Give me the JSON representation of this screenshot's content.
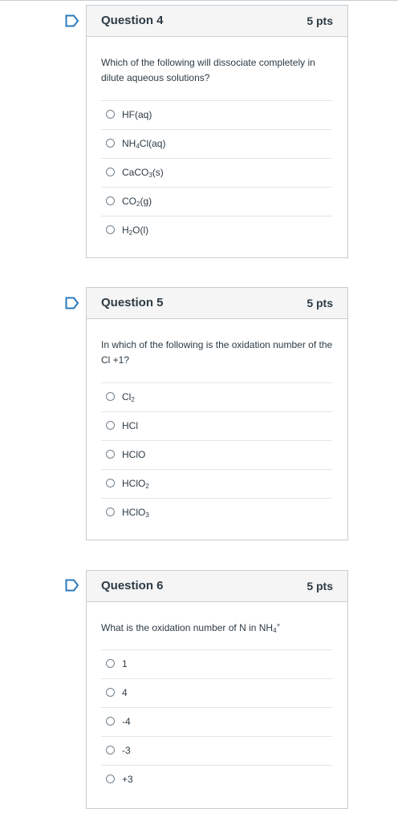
{
  "questions": [
    {
      "title": "Question 4",
      "points": "5 pts",
      "text": "Which of the following will dissociate completely in dilute aqueous solutions?",
      "answers": [
        {
          "label": "HF(aq)"
        },
        {
          "pre": "NH",
          "sub": "4",
          "post": "Cl(aq)"
        },
        {
          "pre": "CaCO",
          "sub": "3",
          "post": "(s)"
        },
        {
          "pre": "CO",
          "sub": "2",
          "post": "(g)"
        },
        {
          "pre": "H",
          "sub": "2",
          "post": "O(l)"
        }
      ]
    },
    {
      "title": "Question 5",
      "points": "5 pts",
      "text": "In which of the following is the oxidation number of the Cl +1?",
      "answers": [
        {
          "pre": "Cl",
          "sub": "2",
          "post": ""
        },
        {
          "label": "HCl"
        },
        {
          "label": "HClO"
        },
        {
          "pre": "HClO",
          "sub": "2",
          "post": ""
        },
        {
          "pre": "HClO",
          "sub": "3",
          "post": ""
        }
      ]
    },
    {
      "title": "Question 6",
      "points": "5 pts",
      "text_pre": "What is the oxidation number of N in NH",
      "text_sub": "4",
      "text_sup": "+",
      "answers": [
        {
          "label": "1"
        },
        {
          "label": "4"
        },
        {
          "label": "-4"
        },
        {
          "label": "-3"
        },
        {
          "label": "+3"
        }
      ]
    }
  ],
  "colors": {
    "text": "#2d3b45",
    "border": "#c7cdd1",
    "header_bg": "#f5f5f5",
    "flag": "#2b7abc"
  },
  "icons": {
    "flag": "bookmark-flag-icon",
    "radio": "radio-circle-icon"
  }
}
